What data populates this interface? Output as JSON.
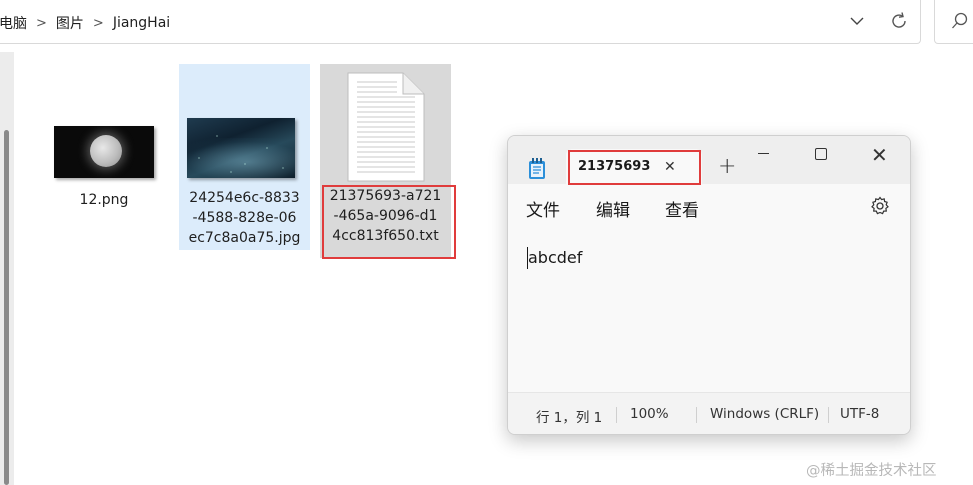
{
  "explorer": {
    "breadcrumbs": [
      "此电脑",
      "图片",
      "JiangHai"
    ],
    "files": [
      {
        "name": "12.png",
        "thumbnail": "moon-image"
      },
      {
        "name_lines": [
          "24254e6c-8833",
          "-4588-828e-06",
          "ec7c8a0a75.jpg"
        ],
        "thumbnail": "space-image",
        "selected": true
      },
      {
        "name_lines": [
          "21375693-a721",
          "-465a-9096-d1",
          "4cc813f650.txt"
        ],
        "thumbnail": "text-document-icon",
        "highlighted": true
      }
    ]
  },
  "notepad": {
    "tab_title": "21375693",
    "menu": [
      "文件",
      "编辑",
      "查看"
    ],
    "content": "abcdef",
    "status": {
      "position": "行 1，列 1",
      "zoom": "100%",
      "line_ending": "Windows (CRLF)",
      "encoding": "UTF-8"
    }
  },
  "watermark": "@稀土掘金技术社区",
  "colors": {
    "annotation_red": "#e03c3c",
    "selection_blue": "#dcecfb",
    "highlight_gray": "#d9d9d9"
  }
}
